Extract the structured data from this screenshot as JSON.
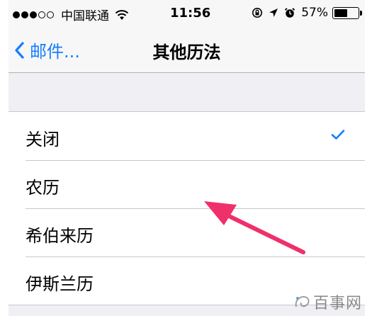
{
  "status_bar": {
    "carrier": "中国联通",
    "time": "11:56",
    "battery_percent": "57%",
    "battery_level": 0.57,
    "signal_bars_filled": 3,
    "signal_bars_total": 5
  },
  "nav": {
    "back_label": "邮件...",
    "title": "其他历法"
  },
  "calendar_options": [
    {
      "label": "关闭",
      "selected": true
    },
    {
      "label": "农历",
      "selected": false
    },
    {
      "label": "希伯来历",
      "selected": false
    },
    {
      "label": "伊斯兰历",
      "selected": false
    }
  ],
  "watermark": {
    "text": "百事网"
  },
  "colors": {
    "accent": "#157efb",
    "annotation_arrow": "#f0306a",
    "background": "#efeff4"
  }
}
